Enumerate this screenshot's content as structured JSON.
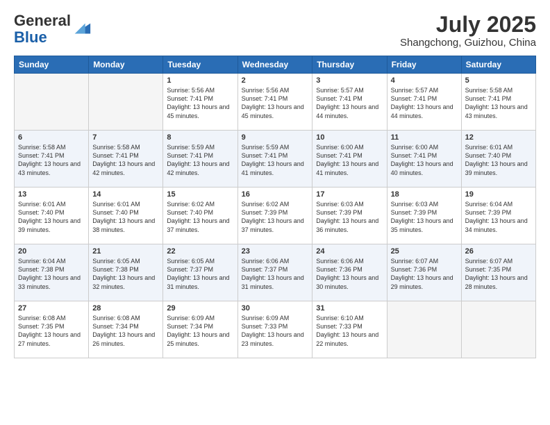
{
  "header": {
    "logo_general": "General",
    "logo_blue": "Blue",
    "month_year": "July 2025",
    "location": "Shangchong, Guizhou, China"
  },
  "days_of_week": [
    "Sunday",
    "Monday",
    "Tuesday",
    "Wednesday",
    "Thursday",
    "Friday",
    "Saturday"
  ],
  "weeks": [
    [
      {
        "day": "",
        "sunrise": "",
        "sunset": "",
        "daylight": ""
      },
      {
        "day": "",
        "sunrise": "",
        "sunset": "",
        "daylight": ""
      },
      {
        "day": "1",
        "sunrise": "Sunrise: 5:56 AM",
        "sunset": "Sunset: 7:41 PM",
        "daylight": "Daylight: 13 hours and 45 minutes."
      },
      {
        "day": "2",
        "sunrise": "Sunrise: 5:56 AM",
        "sunset": "Sunset: 7:41 PM",
        "daylight": "Daylight: 13 hours and 45 minutes."
      },
      {
        "day": "3",
        "sunrise": "Sunrise: 5:57 AM",
        "sunset": "Sunset: 7:41 PM",
        "daylight": "Daylight: 13 hours and 44 minutes."
      },
      {
        "day": "4",
        "sunrise": "Sunrise: 5:57 AM",
        "sunset": "Sunset: 7:41 PM",
        "daylight": "Daylight: 13 hours and 44 minutes."
      },
      {
        "day": "5",
        "sunrise": "Sunrise: 5:58 AM",
        "sunset": "Sunset: 7:41 PM",
        "daylight": "Daylight: 13 hours and 43 minutes."
      }
    ],
    [
      {
        "day": "6",
        "sunrise": "Sunrise: 5:58 AM",
        "sunset": "Sunset: 7:41 PM",
        "daylight": "Daylight: 13 hours and 43 minutes."
      },
      {
        "day": "7",
        "sunrise": "Sunrise: 5:58 AM",
        "sunset": "Sunset: 7:41 PM",
        "daylight": "Daylight: 13 hours and 42 minutes."
      },
      {
        "day": "8",
        "sunrise": "Sunrise: 5:59 AM",
        "sunset": "Sunset: 7:41 PM",
        "daylight": "Daylight: 13 hours and 42 minutes."
      },
      {
        "day": "9",
        "sunrise": "Sunrise: 5:59 AM",
        "sunset": "Sunset: 7:41 PM",
        "daylight": "Daylight: 13 hours and 41 minutes."
      },
      {
        "day": "10",
        "sunrise": "Sunrise: 6:00 AM",
        "sunset": "Sunset: 7:41 PM",
        "daylight": "Daylight: 13 hours and 41 minutes."
      },
      {
        "day": "11",
        "sunrise": "Sunrise: 6:00 AM",
        "sunset": "Sunset: 7:41 PM",
        "daylight": "Daylight: 13 hours and 40 minutes."
      },
      {
        "day": "12",
        "sunrise": "Sunrise: 6:01 AM",
        "sunset": "Sunset: 7:40 PM",
        "daylight": "Daylight: 13 hours and 39 minutes."
      }
    ],
    [
      {
        "day": "13",
        "sunrise": "Sunrise: 6:01 AM",
        "sunset": "Sunset: 7:40 PM",
        "daylight": "Daylight: 13 hours and 39 minutes."
      },
      {
        "day": "14",
        "sunrise": "Sunrise: 6:01 AM",
        "sunset": "Sunset: 7:40 PM",
        "daylight": "Daylight: 13 hours and 38 minutes."
      },
      {
        "day": "15",
        "sunrise": "Sunrise: 6:02 AM",
        "sunset": "Sunset: 7:40 PM",
        "daylight": "Daylight: 13 hours and 37 minutes."
      },
      {
        "day": "16",
        "sunrise": "Sunrise: 6:02 AM",
        "sunset": "Sunset: 7:39 PM",
        "daylight": "Daylight: 13 hours and 37 minutes."
      },
      {
        "day": "17",
        "sunrise": "Sunrise: 6:03 AM",
        "sunset": "Sunset: 7:39 PM",
        "daylight": "Daylight: 13 hours and 36 minutes."
      },
      {
        "day": "18",
        "sunrise": "Sunrise: 6:03 AM",
        "sunset": "Sunset: 7:39 PM",
        "daylight": "Daylight: 13 hours and 35 minutes."
      },
      {
        "day": "19",
        "sunrise": "Sunrise: 6:04 AM",
        "sunset": "Sunset: 7:39 PM",
        "daylight": "Daylight: 13 hours and 34 minutes."
      }
    ],
    [
      {
        "day": "20",
        "sunrise": "Sunrise: 6:04 AM",
        "sunset": "Sunset: 7:38 PM",
        "daylight": "Daylight: 13 hours and 33 minutes."
      },
      {
        "day": "21",
        "sunrise": "Sunrise: 6:05 AM",
        "sunset": "Sunset: 7:38 PM",
        "daylight": "Daylight: 13 hours and 32 minutes."
      },
      {
        "day": "22",
        "sunrise": "Sunrise: 6:05 AM",
        "sunset": "Sunset: 7:37 PM",
        "daylight": "Daylight: 13 hours and 31 minutes."
      },
      {
        "day": "23",
        "sunrise": "Sunrise: 6:06 AM",
        "sunset": "Sunset: 7:37 PM",
        "daylight": "Daylight: 13 hours and 31 minutes."
      },
      {
        "day": "24",
        "sunrise": "Sunrise: 6:06 AM",
        "sunset": "Sunset: 7:36 PM",
        "daylight": "Daylight: 13 hours and 30 minutes."
      },
      {
        "day": "25",
        "sunrise": "Sunrise: 6:07 AM",
        "sunset": "Sunset: 7:36 PM",
        "daylight": "Daylight: 13 hours and 29 minutes."
      },
      {
        "day": "26",
        "sunrise": "Sunrise: 6:07 AM",
        "sunset": "Sunset: 7:35 PM",
        "daylight": "Daylight: 13 hours and 28 minutes."
      }
    ],
    [
      {
        "day": "27",
        "sunrise": "Sunrise: 6:08 AM",
        "sunset": "Sunset: 7:35 PM",
        "daylight": "Daylight: 13 hours and 27 minutes."
      },
      {
        "day": "28",
        "sunrise": "Sunrise: 6:08 AM",
        "sunset": "Sunset: 7:34 PM",
        "daylight": "Daylight: 13 hours and 26 minutes."
      },
      {
        "day": "29",
        "sunrise": "Sunrise: 6:09 AM",
        "sunset": "Sunset: 7:34 PM",
        "daylight": "Daylight: 13 hours and 25 minutes."
      },
      {
        "day": "30",
        "sunrise": "Sunrise: 6:09 AM",
        "sunset": "Sunset: 7:33 PM",
        "daylight": "Daylight: 13 hours and 23 minutes."
      },
      {
        "day": "31",
        "sunrise": "Sunrise: 6:10 AM",
        "sunset": "Sunset: 7:33 PM",
        "daylight": "Daylight: 13 hours and 22 minutes."
      },
      {
        "day": "",
        "sunrise": "",
        "sunset": "",
        "daylight": ""
      },
      {
        "day": "",
        "sunrise": "",
        "sunset": "",
        "daylight": ""
      }
    ]
  ]
}
